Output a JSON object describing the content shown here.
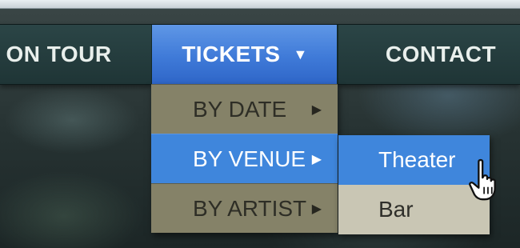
{
  "nav": {
    "items": [
      {
        "label": "S ON TOUR"
      },
      {
        "label": "TICKETS",
        "caret_icon": "caret-down-icon"
      },
      {
        "label": "CONTACT"
      }
    ]
  },
  "dropdown": {
    "items": [
      {
        "label": "BY DATE",
        "arrow_icon": "arrow-right-icon"
      },
      {
        "label": "BY VENUE",
        "arrow_icon": "arrow-right-icon"
      },
      {
        "label": "BY ARTIST",
        "arrow_icon": "arrow-right-icon"
      }
    ]
  },
  "submenu": {
    "items": [
      {
        "label": "Theater"
      },
      {
        "label": "Bar"
      }
    ]
  },
  "colors": {
    "accent_blue": "#3f86dc",
    "navbar": "#2b4546",
    "menu_item": "#858268",
    "submenu_item": "#c9c6b4"
  },
  "cursor_icon": "hand-pointer-icon"
}
